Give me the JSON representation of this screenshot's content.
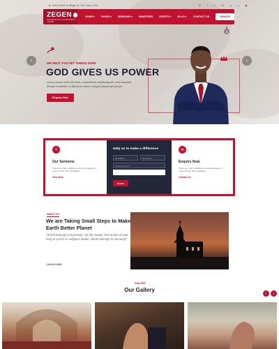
{
  "topbar": {
    "address": "1004 West College St, Sun City, USA",
    "social_icons": [
      "phone-icon",
      "facebook-icon",
      "twitter-icon",
      "dribbble-icon",
      "pinterest-icon",
      "vimeo-icon",
      "youtube-icon"
    ]
  },
  "nav": {
    "brand": "ZEGEN",
    "tagline": "PROFESSIONAL WORDPRESS THEME",
    "items": [
      "HOME ▾",
      "PAGES ▾",
      "SERMONS ▾",
      "MINISTRIES",
      "EVENTS ▾",
      "BLOG ▾",
      "CONTACT US"
    ],
    "donate_label": "DONATE"
  },
  "hero": {
    "kicker": "WE HELP YOU GET THINGS DONE",
    "title": "GOD GIVES US POWER",
    "subtitle": "Lorem ipsum dolor sit amet, consectetur adipiscing elit, sed eiusmod tempor incididunt ut labore et dolore magna aliqua sus ipsum.",
    "button": "Enquiry Now",
    "prev": "‹",
    "next": "›"
  },
  "info": {
    "sermons": {
      "title": "Our Sermons",
      "text": "There are many variations words passages of Lorem Ipsum don't available.",
      "link": "View More"
    },
    "difference": {
      "title": "Help us to make a difference",
      "amount1": "$2,000.00",
      "amount2": "$4,000.00",
      "custom": "Custom Amount",
      "button": "Donate"
    },
    "enquiry": {
      "title": "Enquiry Now",
      "text": "There are many variations words passages of Lorem Ipsum don't available.",
      "link": "Contact Us"
    }
  },
  "about": {
    "tag": "ABOUT US",
    "title": "We are Taking Small Steps to Make Earth Better Planet",
    "quote": "\"World belongs to humanity, not this leader, that leader or that King or prince or religious leader. World belongs to humanity\"",
    "author": "- DALAI LAMA"
  },
  "gallery": {
    "tag": "GALLERY",
    "title": "Our Gallery",
    "prev": "‹",
    "next": "›"
  },
  "colors": {
    "accent": "#c1122f",
    "dark": "#23273a"
  }
}
